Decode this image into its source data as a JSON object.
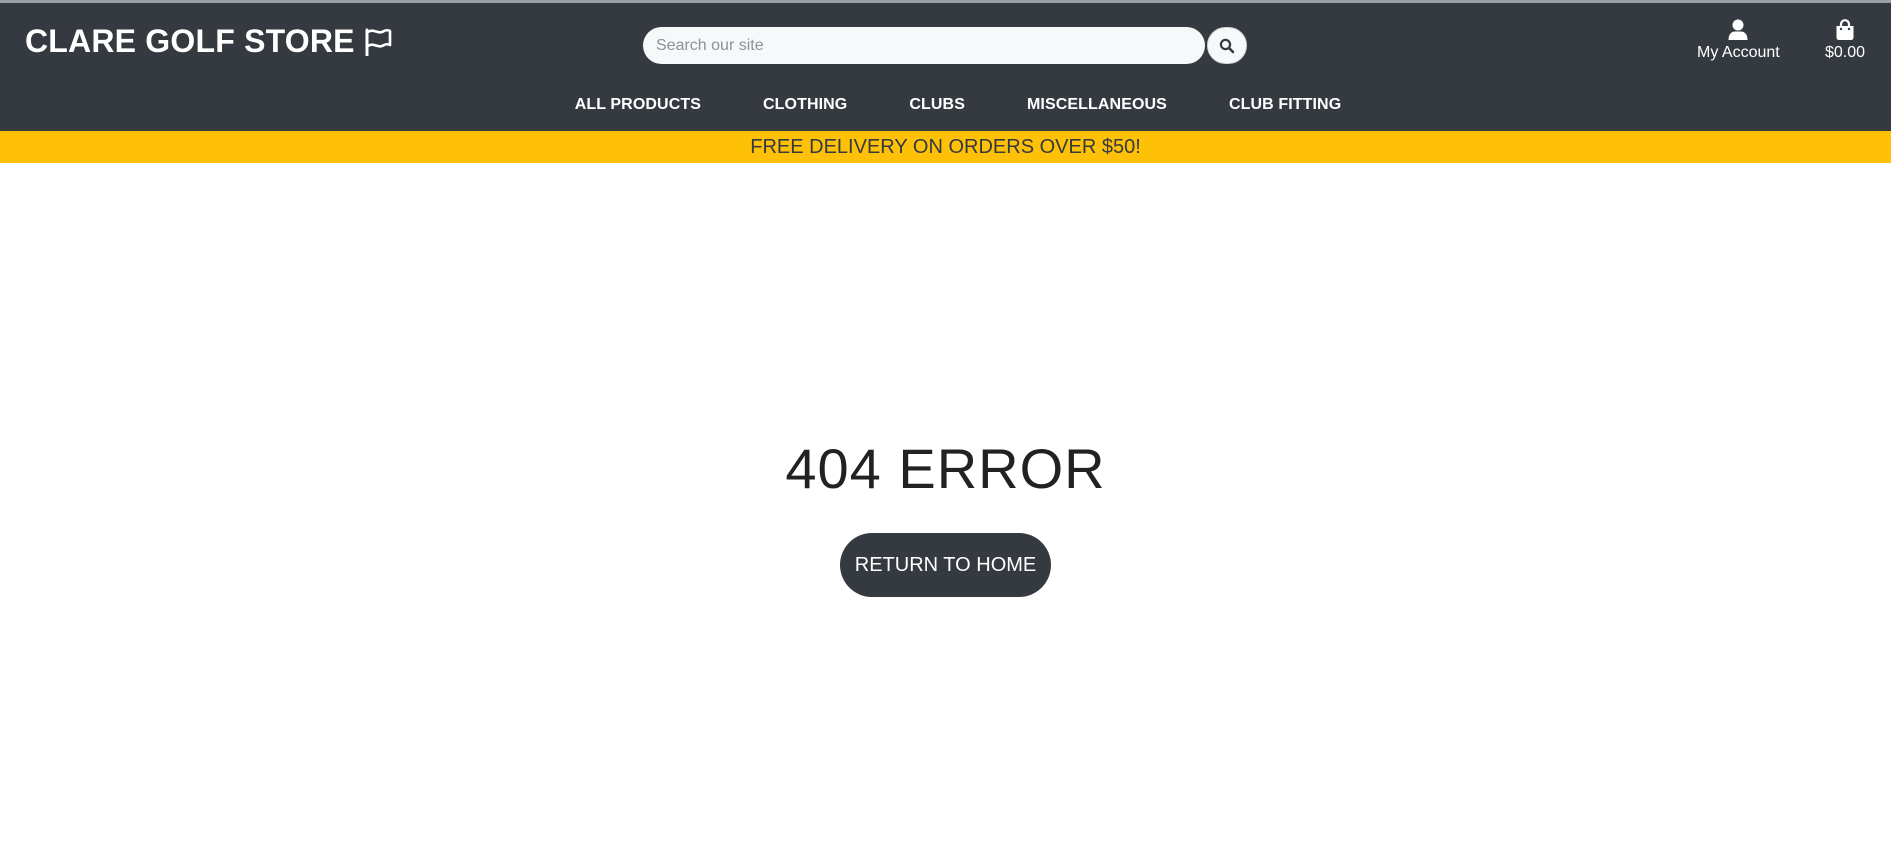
{
  "header": {
    "brand": "CLARE GOLF STORE",
    "search": {
      "placeholder": "Search our site",
      "value": ""
    },
    "account_label": "My Account",
    "bag_total": "$0.00"
  },
  "nav": {
    "items": [
      {
        "label": "ALL PRODUCTS"
      },
      {
        "label": "CLOTHING"
      },
      {
        "label": "CLUBS"
      },
      {
        "label": "MISCELLANEOUS"
      },
      {
        "label": "CLUB FITTING"
      }
    ]
  },
  "banner": {
    "text": "FREE DELIVERY ON ORDERS OVER $50!"
  },
  "main": {
    "title": "404 ERROR",
    "button_label": "RETURN TO HOME"
  },
  "icons": {
    "brand": "flag-icon",
    "search": "search-icon",
    "account": "user-icon",
    "bag": "shopping-bag-icon"
  },
  "colors": {
    "header_bg": "#343a40",
    "banner_bg": "#ffc107",
    "text_light": "#ffffff",
    "button_bg": "#343a40"
  }
}
